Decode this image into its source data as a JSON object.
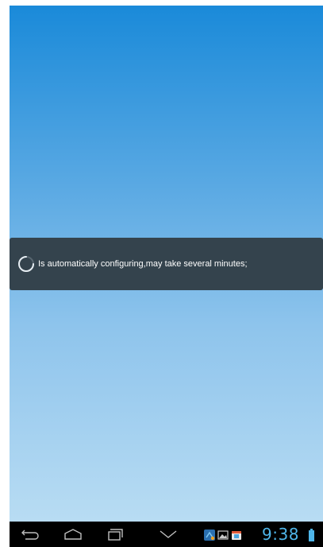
{
  "dialog": {
    "message": "Is automatically configuring,may take several minutes;"
  },
  "navbar": {
    "back_icon": "back-arrow-icon",
    "home_icon": "home-icon",
    "recents_icon": "recent-apps-icon",
    "hide_keyboard_icon": "chevron-down-icon"
  },
  "status": {
    "time": "9:38",
    "notification_icons": [
      "network-tool-icon",
      "gallery-icon",
      "store-icon"
    ],
    "battery_icon": "battery-icon"
  },
  "colors": {
    "gradient_top": "#1a8ad9",
    "gradient_bottom": "#b8dcf3",
    "dialog_bg": "#34434d",
    "clock": "#4fb6ea",
    "navbar_bg": "#000000"
  }
}
